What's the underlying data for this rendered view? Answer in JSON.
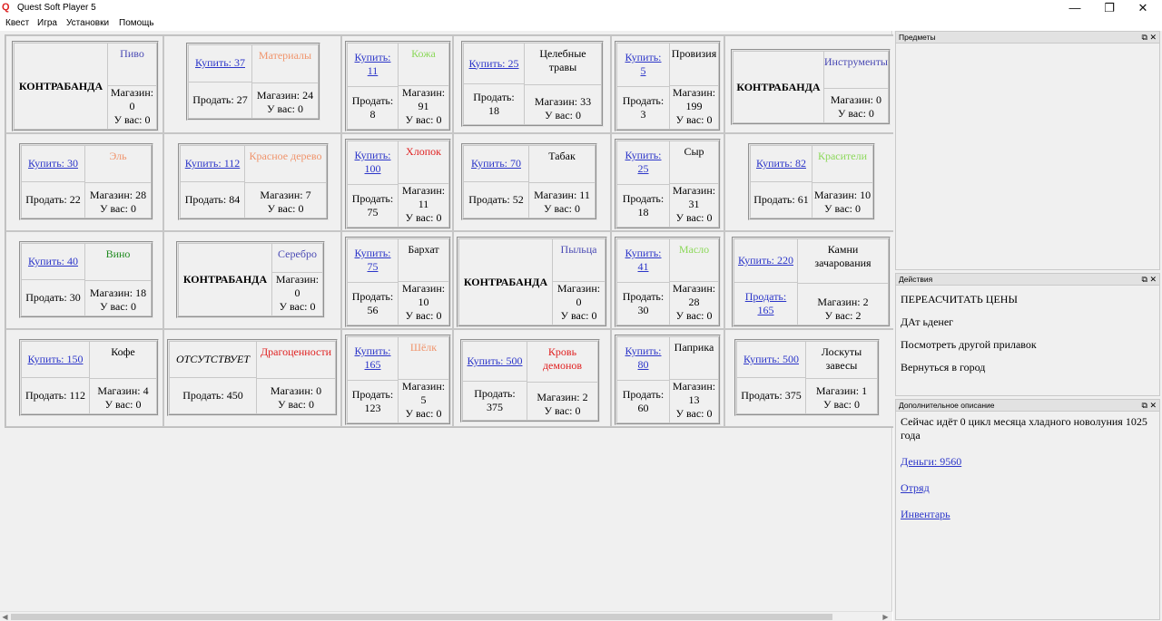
{
  "window": {
    "title": "Quest Soft Player 5",
    "minimize": "—",
    "maximize": "❐",
    "close": "✕"
  },
  "menu": [
    "Квест",
    "Игра",
    "Установки",
    "Помощь"
  ],
  "panels": {
    "items": {
      "title": "Предметы",
      "controls": "⧉ ✕"
    },
    "actions": {
      "title": "Действия",
      "controls": "⧉ ✕",
      "list": [
        "ПЕРЕАСЧИТАТЬ ЦЕНЫ",
        "ДАт ьденег",
        "Посмотреть другой прилавок",
        "Вернуться в город"
      ]
    },
    "desc": {
      "title": "Дополнительное описание",
      "controls": "⧉ ✕",
      "text": "Сейчас идёт 0 цикл месяца хладного новолуния 1025 года",
      "money": "Деньги: 9560",
      "squad": "Отряд",
      "inventory": "Инвентарь"
    }
  },
  "goods": [
    [
      {
        "contraband": "КОНТРАБАНДА",
        "name": "Пиво",
        "color": "#4a4ab4",
        "shop": "Магазин:\n0",
        "have": "У вас: 0"
      },
      {
        "buy": "Купить: 37",
        "sell": "Продать: 27",
        "name": "Материалы",
        "color": "#f0946c",
        "shop": "Магазин: 24",
        "have": "У вас: 0"
      },
      {
        "buy": "Купить:\n11",
        "sell": "Продать:\n8",
        "name": "Кожа",
        "color": "#8cd85a",
        "shop": "Магазин:\n91",
        "have": "У вас: 0"
      },
      {
        "buy": "Купить: 25",
        "sell": "Продать:\n18",
        "name": "Целебные\nтравы",
        "color": "#000000",
        "shop": "Магазин: 33",
        "have": "У вас: 0"
      },
      {
        "buy": "Купить:\n5",
        "sell": "Продать:\n3",
        "name": "Провизия",
        "color": "#000000",
        "shop": "Магазин:\n199",
        "have": "У вас: 0"
      },
      {
        "contraband": "КОНТРАБАНДА",
        "name": "Инструменты",
        "color": "#4a4ab4",
        "shop": "Магазин: 0",
        "have": "У вас: 0"
      }
    ],
    [
      {
        "buy": "Купить: 30",
        "sell": "Продать: 22",
        "name": "Эль",
        "color": "#f0946c",
        "shop": "Магазин: 28",
        "have": "У вас: 0"
      },
      {
        "buy": "Купить: 112",
        "sell": "Продать: 84",
        "name": "Красное дерево",
        "color": "#f0946c",
        "shop": "Магазин: 7",
        "have": "У вас: 0"
      },
      {
        "buy": "Купить:\n100",
        "sell": "Продать:\n75",
        "name": "Хлопок",
        "color": "#e02020",
        "shop": "Магазин:\n11",
        "have": "У вас: 0"
      },
      {
        "buy": "Купить: 70",
        "sell": "Продать: 52",
        "name": "Табак",
        "color": "#000000",
        "shop": "Магазин: 11",
        "have": "У вас: 0"
      },
      {
        "buy": "Купить:\n25",
        "sell": "Продать:\n18",
        "name": "Сыр",
        "color": "#000000",
        "shop": "Магазин:\n31",
        "have": "У вас: 0"
      },
      {
        "buy": "Купить: 82",
        "sell": "Продать: 61",
        "name": "Красители",
        "color": "#8cd85a",
        "shop": "Магазин: 10",
        "have": "У вас: 0"
      }
    ],
    [
      {
        "buy": "Купить: 40",
        "sell": "Продать: 30",
        "name": "Вино",
        "color": "#1e8a1e",
        "shop": "Магазин: 18",
        "have": "У вас: 0"
      },
      {
        "contraband": "КОНТРАБАНДА",
        "name": "Серебро",
        "color": "#4a4ab4",
        "shop": "Магазин: 0",
        "have": "У вас: 0"
      },
      {
        "buy": "Купить:\n75",
        "sell": "Продать:\n56",
        "name": "Бархат",
        "color": "#000000",
        "shop": "Магазин:\n10",
        "have": "У вас: 0"
      },
      {
        "contraband": "КОНТРАБАНДА",
        "name": "Пыльца",
        "color": "#4a4ab4",
        "shop": "Магазин:\n0",
        "have": "У вас: 0"
      },
      {
        "buy": "Купить:\n41",
        "sell": "Продать:\n30",
        "name": "Масло",
        "color": "#8cd85a",
        "shop": "Магазин:\n28",
        "have": "У вас: 0"
      },
      {
        "buy": "Купить: 220",
        "sell": "Продать:\n165",
        "sell_link": true,
        "name": "Камни\nзачарования",
        "color": "#000000",
        "shop": "Магазин: 2",
        "have": "У вас: 2"
      }
    ],
    [
      {
        "buy": "Купить: 150",
        "sell": "Продать: 112",
        "name": "Кофе",
        "color": "#000000",
        "shop": "Магазин: 4",
        "have": "У вас: 0"
      },
      {
        "absent": "ОТСУТСТВУЕТ",
        "sell": "Продать: 450",
        "name": "Драгоценности",
        "color": "#e02020",
        "shop": "Магазин: 0",
        "have": "У вас: 0"
      },
      {
        "buy": "Купить:\n165",
        "sell": "Продать:\n123",
        "name": "Шёлк",
        "color": "#f0946c",
        "shop": "Магазин:\n5",
        "have": "У вас: 0"
      },
      {
        "buy": "Купить: 500",
        "sell": "Продать:\n375",
        "name": "Кровь\nдемонов",
        "color": "#e02020",
        "shop": "Магазин: 2",
        "have": "У вас: 0"
      },
      {
        "buy": "Купить:\n80",
        "sell": "Продать:\n60",
        "name": "Паприка",
        "color": "#000000",
        "shop": "Магазин:\n13",
        "have": "У вас: 0"
      },
      {
        "buy": "Купить: 500",
        "sell": "Продать: 375",
        "name": "Лоскуты завесы",
        "color": "#000000",
        "shop": "Магазин: 1",
        "have": "У вас: 0"
      }
    ]
  ]
}
